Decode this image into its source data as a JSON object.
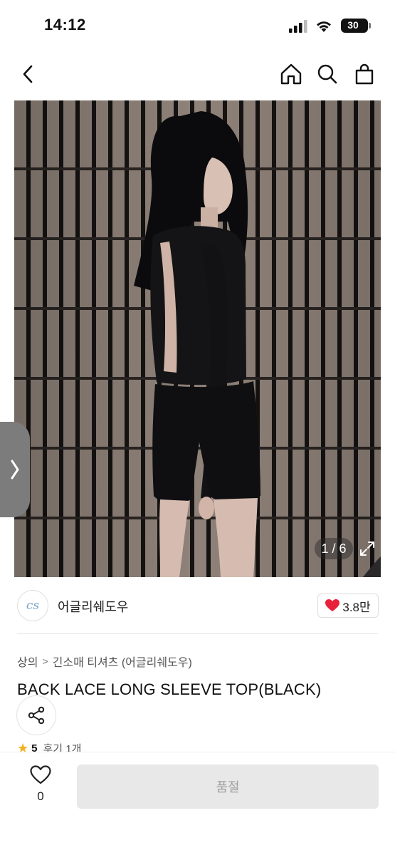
{
  "status": {
    "time": "14:12",
    "battery": "30"
  },
  "nav": {
    "icons": [
      "back-icon",
      "home-icon",
      "search-icon",
      "shopping-bag-icon"
    ]
  },
  "gallery": {
    "counter": "1 / 6",
    "icons": [
      "expand-icon",
      "chevron-right-icon"
    ]
  },
  "seller": {
    "logo_text": "cs",
    "name": "어글리쉐도우",
    "likes": "3.8만"
  },
  "breadcrumb": {
    "category": "상의",
    "subcategory": "긴소매 티셔츠 (어글리쉐도우)"
  },
  "product": {
    "title": "BACK LACE LONG SLEEVE TOP(BLACK)",
    "rating": "5",
    "reviews": "후기 1개"
  },
  "bottom": {
    "wish_count": "0",
    "soldout_label": "품절"
  },
  "colors": {
    "heart": "#e8213a",
    "star": "#f2b01e",
    "disabled_button": "#e8e8e8"
  }
}
